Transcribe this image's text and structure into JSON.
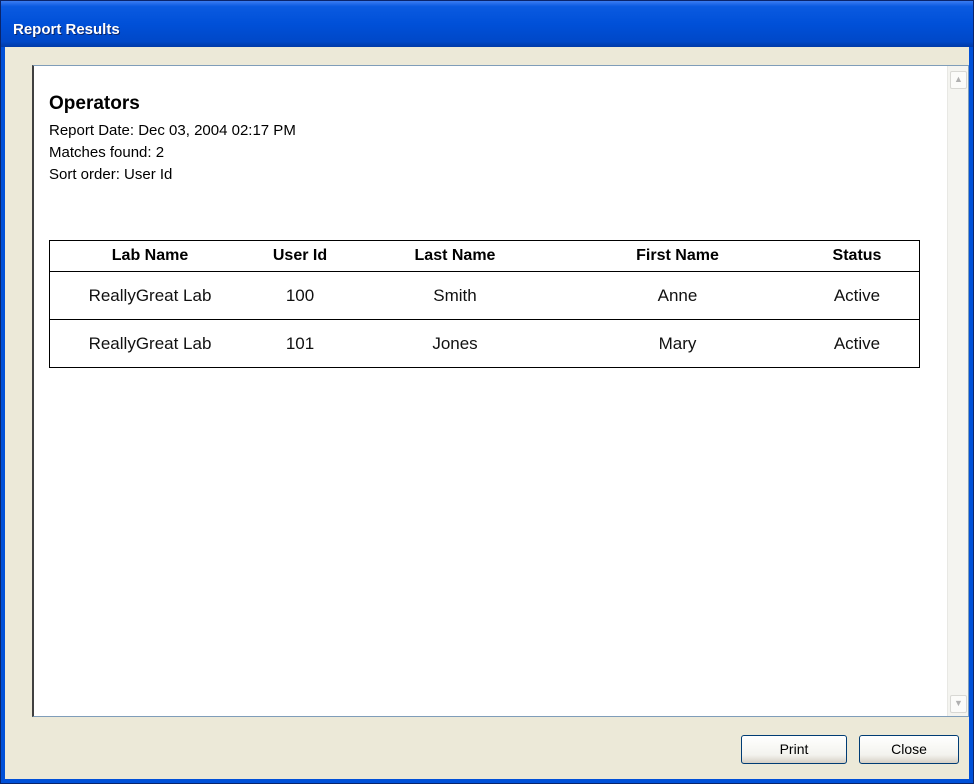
{
  "window": {
    "title": "Report Results"
  },
  "report": {
    "title": "Operators",
    "report_date": "Report Date: Dec 03, 2004 02:17 PM",
    "matches": "Matches found: 2",
    "sort_order": "Sort order: User Id"
  },
  "table": {
    "headers": [
      "Lab Name",
      "User Id",
      "Last Name",
      "First Name",
      "Status"
    ],
    "rows": [
      [
        "ReallyGreat Lab",
        "100",
        "Smith",
        "Anne",
        "Active"
      ],
      [
        "ReallyGreat Lab",
        "101",
        "Jones",
        "Mary",
        "Active"
      ]
    ]
  },
  "buttons": {
    "print": "Print",
    "close": "Close"
  },
  "icons": {
    "scroll_up": "scroll-up-arrow-icon",
    "scroll_down": "scroll-down-arrow-icon"
  },
  "colors": {
    "titlebar": "#0050d8",
    "window_bg": "#ece9d8"
  }
}
